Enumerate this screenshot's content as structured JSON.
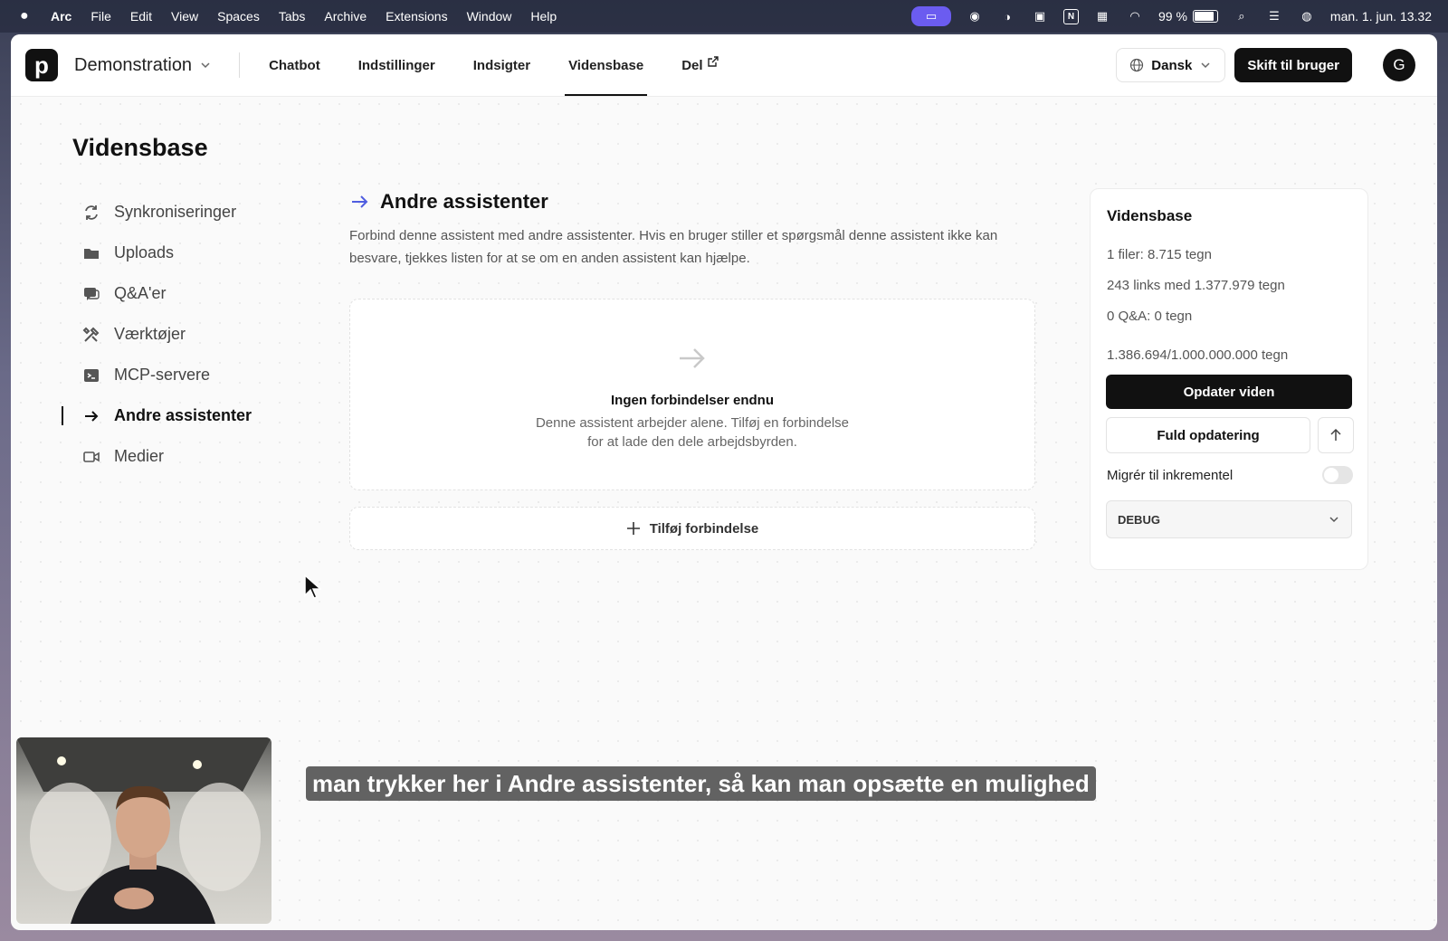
{
  "menubar": {
    "items": [
      "Arc",
      "File",
      "Edit",
      "View",
      "Spaces",
      "Tabs",
      "Archive",
      "Extensions",
      "Window",
      "Help"
    ],
    "battery": "99 %",
    "clock": "man. 1. jun. 13.32"
  },
  "header": {
    "project": "Demonstration",
    "tabs": [
      {
        "label": "Chatbot"
      },
      {
        "label": "Indstillinger"
      },
      {
        "label": "Indsigter"
      },
      {
        "label": "Vidensbase"
      },
      {
        "label": "Del"
      }
    ],
    "language": "Dansk",
    "switch_label": "Skift til bruger",
    "avatar_initial": "G"
  },
  "page": {
    "title": "Vidensbase"
  },
  "sidebar": {
    "items": [
      {
        "label": "Synkroniseringer",
        "icon": "sync-icon"
      },
      {
        "label": "Uploads",
        "icon": "folder-icon"
      },
      {
        "label": "Q&A'er",
        "icon": "chat-icon"
      },
      {
        "label": "Værktøjer",
        "icon": "tools-icon"
      },
      {
        "label": "MCP-servere",
        "icon": "terminal-icon"
      },
      {
        "label": "Andre assistenter",
        "icon": "arrow-right-icon"
      },
      {
        "label": "Medier",
        "icon": "video-icon"
      }
    ]
  },
  "main": {
    "title": "Andre assistenter",
    "description": "Forbind denne assistent med andre assistenter. Hvis en bruger stiller et spørgsmål denne assistent ikke kan besvare, tjekkes listen for at se om en anden assistent kan hjælpe.",
    "empty_title": "Ingen forbindelser endnu",
    "empty_text": "Denne assistent arbejder alene. Tilføj en forbindelse for at lade den dele arbejdsbyrden.",
    "add_label": "Tilføj forbindelse"
  },
  "card": {
    "title": "Vidensbase",
    "files": "1 filer: 8.715 tegn",
    "links": "243 links med 1.377.979 tegn",
    "qa": "0 Q&A: 0 tegn",
    "total": "1.386.694/1.000.000.000 tegn",
    "update_label": "Opdater viden",
    "full_update_label": "Fuld opdatering",
    "migrate_label": "Migrér til inkrementel",
    "debug_label": "DEBUG"
  },
  "caption": "man trykker her i Andre assistenter, så kan man opsætte en mulighed",
  "colors": {
    "accent": "#4f5de0",
    "primary": "#111111"
  }
}
